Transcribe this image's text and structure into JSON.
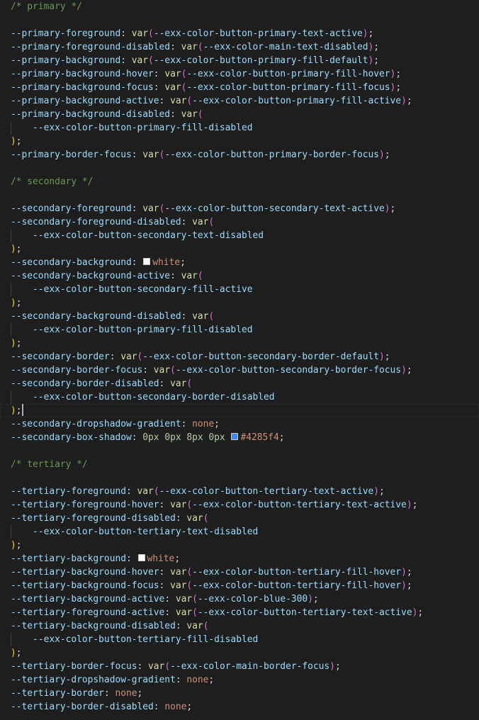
{
  "editor": {
    "colors": {
      "background": "#1e1e1e",
      "comment": "#6a9955",
      "property": "#9cdcfe",
      "function": "#dcdcaa",
      "paren": "#da70d6",
      "closing_paren": "#ffd700",
      "value": "#ce9178",
      "number": "#b5cea8",
      "punctuation": "#d4d4d4"
    },
    "cursor_line": 30,
    "lines": [
      {
        "tokens": [
          {
            "t": "/* primary */",
            "c": "comment"
          }
        ]
      },
      {
        "tokens": []
      },
      {
        "tokens": [
          {
            "t": "--primary-foreground",
            "c": "prop"
          },
          {
            "t": ": ",
            "c": "punct"
          },
          {
            "t": "var",
            "c": "fn"
          },
          {
            "t": "(",
            "c": "paren1"
          },
          {
            "t": "--exx-color-button-primary-text-active",
            "c": "var"
          },
          {
            "t": ")",
            "c": "paren1"
          },
          {
            "t": ";",
            "c": "punct"
          }
        ]
      },
      {
        "tokens": [
          {
            "t": "--primary-foreground-disabled",
            "c": "prop"
          },
          {
            "t": ": ",
            "c": "punct"
          },
          {
            "t": "var",
            "c": "fn"
          },
          {
            "t": "(",
            "c": "paren1"
          },
          {
            "t": "--exx-color-main-text-disabled",
            "c": "var"
          },
          {
            "t": ")",
            "c": "paren1"
          },
          {
            "t": ";",
            "c": "punct"
          }
        ]
      },
      {
        "tokens": [
          {
            "t": "--primary-background",
            "c": "prop"
          },
          {
            "t": ": ",
            "c": "punct"
          },
          {
            "t": "var",
            "c": "fn"
          },
          {
            "t": "(",
            "c": "paren1"
          },
          {
            "t": "--exx-color-button-primary-fill-default",
            "c": "var"
          },
          {
            "t": ")",
            "c": "paren1"
          },
          {
            "t": ";",
            "c": "punct"
          }
        ]
      },
      {
        "tokens": [
          {
            "t": "--primary-background-hover",
            "c": "prop"
          },
          {
            "t": ": ",
            "c": "punct"
          },
          {
            "t": "var",
            "c": "fn"
          },
          {
            "t": "(",
            "c": "paren1"
          },
          {
            "t": "--exx-color-button-primary-fill-hover",
            "c": "var"
          },
          {
            "t": ")",
            "c": "paren1"
          },
          {
            "t": ";",
            "c": "punct"
          }
        ]
      },
      {
        "tokens": [
          {
            "t": "--primary-background-focus",
            "c": "prop"
          },
          {
            "t": ": ",
            "c": "punct"
          },
          {
            "t": "var",
            "c": "fn"
          },
          {
            "t": "(",
            "c": "paren1"
          },
          {
            "t": "--exx-color-button-primary-fill-focus",
            "c": "var"
          },
          {
            "t": ")",
            "c": "paren1"
          },
          {
            "t": ";",
            "c": "punct"
          }
        ]
      },
      {
        "tokens": [
          {
            "t": "--primary-background-active",
            "c": "prop"
          },
          {
            "t": ": ",
            "c": "punct"
          },
          {
            "t": "var",
            "c": "fn"
          },
          {
            "t": "(",
            "c": "paren1"
          },
          {
            "t": "--exx-color-button-primary-fill-active",
            "c": "var"
          },
          {
            "t": ")",
            "c": "paren1"
          },
          {
            "t": ";",
            "c": "punct"
          }
        ]
      },
      {
        "tokens": [
          {
            "t": "--primary-background-disabled",
            "c": "prop"
          },
          {
            "t": ": ",
            "c": "punct"
          },
          {
            "t": "var",
            "c": "fn"
          },
          {
            "t": "(",
            "c": "paren1"
          }
        ]
      },
      {
        "guide": true,
        "tokens": [
          {
            "t": "    --exx-color-button-primary-fill-disabled",
            "c": "var"
          }
        ]
      },
      {
        "tokens": [
          {
            "t": ")",
            "c": "paren0"
          },
          {
            "t": ";",
            "c": "punct"
          }
        ]
      },
      {
        "tokens": [
          {
            "t": "--primary-border-focus",
            "c": "prop"
          },
          {
            "t": ": ",
            "c": "punct"
          },
          {
            "t": "var",
            "c": "fn"
          },
          {
            "t": "(",
            "c": "paren1"
          },
          {
            "t": "--exx-color-button-primary-border-focus",
            "c": "var"
          },
          {
            "t": ")",
            "c": "paren1"
          },
          {
            "t": ";",
            "c": "punct"
          }
        ]
      },
      {
        "tokens": []
      },
      {
        "tokens": [
          {
            "t": "/* secondary */",
            "c": "comment"
          }
        ]
      },
      {
        "tokens": []
      },
      {
        "tokens": [
          {
            "t": "--secondary-foreground",
            "c": "prop"
          },
          {
            "t": ": ",
            "c": "punct"
          },
          {
            "t": "var",
            "c": "fn"
          },
          {
            "t": "(",
            "c": "paren1"
          },
          {
            "t": "--exx-color-button-secondary-text-active",
            "c": "var"
          },
          {
            "t": ")",
            "c": "paren1"
          },
          {
            "t": ";",
            "c": "punct"
          }
        ]
      },
      {
        "tokens": [
          {
            "t": "--secondary-foreground-disabled",
            "c": "prop"
          },
          {
            "t": ": ",
            "c": "punct"
          },
          {
            "t": "var",
            "c": "fn"
          },
          {
            "t": "(",
            "c": "paren1"
          }
        ]
      },
      {
        "guide": true,
        "tokens": [
          {
            "t": "    --exx-color-button-secondary-text-disabled",
            "c": "var"
          }
        ]
      },
      {
        "tokens": [
          {
            "t": ")",
            "c": "paren0"
          },
          {
            "t": ";",
            "c": "punct"
          }
        ]
      },
      {
        "tokens": [
          {
            "t": "--secondary-background",
            "c": "prop"
          },
          {
            "t": ": ",
            "c": "punct"
          },
          {
            "swatch": "#ffffff"
          },
          {
            "t": "white",
            "c": "keyword"
          },
          {
            "t": ";",
            "c": "punct"
          }
        ]
      },
      {
        "tokens": [
          {
            "t": "--secondary-background-active",
            "c": "prop"
          },
          {
            "t": ": ",
            "c": "punct"
          },
          {
            "t": "var",
            "c": "fn"
          },
          {
            "t": "(",
            "c": "paren1"
          }
        ]
      },
      {
        "guide": true,
        "tokens": [
          {
            "t": "    --exx-color-button-secondary-fill-active",
            "c": "var"
          }
        ]
      },
      {
        "tokens": [
          {
            "t": ")",
            "c": "paren0"
          },
          {
            "t": ";",
            "c": "punct"
          }
        ]
      },
      {
        "tokens": [
          {
            "t": "--secondary-background-disabled",
            "c": "prop"
          },
          {
            "t": ": ",
            "c": "punct"
          },
          {
            "t": "var",
            "c": "fn"
          },
          {
            "t": "(",
            "c": "paren1"
          }
        ]
      },
      {
        "guide": true,
        "tokens": [
          {
            "t": "    --exx-color-button-primary-fill-disabled",
            "c": "var"
          }
        ]
      },
      {
        "tokens": [
          {
            "t": ")",
            "c": "paren0"
          },
          {
            "t": ";",
            "c": "punct"
          }
        ]
      },
      {
        "tokens": [
          {
            "t": "--secondary-border",
            "c": "prop"
          },
          {
            "t": ": ",
            "c": "punct"
          },
          {
            "t": "var",
            "c": "fn"
          },
          {
            "t": "(",
            "c": "paren1"
          },
          {
            "t": "--exx-color-button-secondary-border-default",
            "c": "var"
          },
          {
            "t": ")",
            "c": "paren1"
          },
          {
            "t": ";",
            "c": "punct"
          }
        ]
      },
      {
        "tokens": [
          {
            "t": "--secondary-border-focus",
            "c": "prop"
          },
          {
            "t": ": ",
            "c": "punct"
          },
          {
            "t": "var",
            "c": "fn"
          },
          {
            "t": "(",
            "c": "paren1"
          },
          {
            "t": "--exx-color-button-secondary-border-focus",
            "c": "var"
          },
          {
            "t": ")",
            "c": "paren1"
          },
          {
            "t": ";",
            "c": "punct"
          }
        ]
      },
      {
        "tokens": [
          {
            "t": "--secondary-border-disabled",
            "c": "prop"
          },
          {
            "t": ": ",
            "c": "punct"
          },
          {
            "t": "var",
            "c": "fn"
          },
          {
            "t": "(",
            "c": "paren1"
          }
        ]
      },
      {
        "guide": true,
        "tokens": [
          {
            "t": "    --exx-color-button-secondary-border-disabled",
            "c": "var"
          }
        ]
      },
      {
        "tokens": [
          {
            "t": ")",
            "c": "paren0"
          },
          {
            "t": ";",
            "c": "punct"
          },
          {
            "cursor": true
          }
        ]
      },
      {
        "tokens": [
          {
            "t": "--secondary-dropshadow-gradient",
            "c": "prop"
          },
          {
            "t": ": ",
            "c": "punct"
          },
          {
            "t": "none",
            "c": "keyword"
          },
          {
            "t": ";",
            "c": "punct"
          }
        ]
      },
      {
        "tokens": [
          {
            "t": "--secondary-box-shadow",
            "c": "prop"
          },
          {
            "t": ": ",
            "c": "punct"
          },
          {
            "t": "0px 0px 8px 0px ",
            "c": "number"
          },
          {
            "swatch": "#4285f4"
          },
          {
            "t": "#4285f4",
            "c": "keyword"
          },
          {
            "t": ";",
            "c": "punct"
          }
        ]
      },
      {
        "tokens": []
      },
      {
        "tokens": [
          {
            "t": "/* tertiary */",
            "c": "comment"
          }
        ]
      },
      {
        "tokens": []
      },
      {
        "tokens": [
          {
            "t": "--tertiary-foreground",
            "c": "prop"
          },
          {
            "t": ": ",
            "c": "punct"
          },
          {
            "t": "var",
            "c": "fn"
          },
          {
            "t": "(",
            "c": "paren1"
          },
          {
            "t": "--exx-color-button-tertiary-text-active",
            "c": "var"
          },
          {
            "t": ")",
            "c": "paren1"
          },
          {
            "t": ";",
            "c": "punct"
          }
        ]
      },
      {
        "tokens": [
          {
            "t": "--tertiary-foreground-hover",
            "c": "prop"
          },
          {
            "t": ": ",
            "c": "punct"
          },
          {
            "t": "var",
            "c": "fn"
          },
          {
            "t": "(",
            "c": "paren1"
          },
          {
            "t": "--exx-color-button-tertiary-text-active",
            "c": "var"
          },
          {
            "t": ")",
            "c": "paren1"
          },
          {
            "t": ";",
            "c": "punct"
          }
        ]
      },
      {
        "tokens": [
          {
            "t": "--tertiary-foreground-disabled",
            "c": "prop"
          },
          {
            "t": ": ",
            "c": "punct"
          },
          {
            "t": "var",
            "c": "fn"
          },
          {
            "t": "(",
            "c": "paren1"
          }
        ]
      },
      {
        "guide": true,
        "tokens": [
          {
            "t": "    --exx-color-button-tertiary-text-disabled",
            "c": "var"
          }
        ]
      },
      {
        "tokens": [
          {
            "t": ")",
            "c": "paren0"
          },
          {
            "t": ";",
            "c": "punct"
          }
        ]
      },
      {
        "tokens": [
          {
            "t": "--tertiary-background",
            "c": "prop"
          },
          {
            "t": ": ",
            "c": "punct"
          },
          {
            "swatch": "#ffffff"
          },
          {
            "t": "white",
            "c": "keyword"
          },
          {
            "t": ";",
            "c": "punct"
          }
        ]
      },
      {
        "tokens": [
          {
            "t": "--tertiary-background-hover",
            "c": "prop"
          },
          {
            "t": ": ",
            "c": "punct"
          },
          {
            "t": "var",
            "c": "fn"
          },
          {
            "t": "(",
            "c": "paren1"
          },
          {
            "t": "--exx-color-button-tertiary-fill-hover",
            "c": "var"
          },
          {
            "t": ")",
            "c": "paren1"
          },
          {
            "t": ";",
            "c": "punct"
          }
        ]
      },
      {
        "tokens": [
          {
            "t": "--tertiary-background-focus",
            "c": "prop"
          },
          {
            "t": ": ",
            "c": "punct"
          },
          {
            "t": "var",
            "c": "fn"
          },
          {
            "t": "(",
            "c": "paren1"
          },
          {
            "t": "--exx-color-button-tertiary-fill-hover",
            "c": "var"
          },
          {
            "t": ")",
            "c": "paren1"
          },
          {
            "t": ";",
            "c": "punct"
          }
        ]
      },
      {
        "tokens": [
          {
            "t": "--tertiary-background-active",
            "c": "prop"
          },
          {
            "t": ": ",
            "c": "punct"
          },
          {
            "t": "var",
            "c": "fn"
          },
          {
            "t": "(",
            "c": "paren1"
          },
          {
            "t": "--exx-color-blue-300",
            "c": "var"
          },
          {
            "t": ")",
            "c": "paren1"
          },
          {
            "t": ";",
            "c": "punct"
          }
        ]
      },
      {
        "tokens": [
          {
            "t": "--tertiary-foreground-active",
            "c": "prop"
          },
          {
            "t": ": ",
            "c": "punct"
          },
          {
            "t": "var",
            "c": "fn"
          },
          {
            "t": "(",
            "c": "paren1"
          },
          {
            "t": "--exx-color-button-tertiary-text-active",
            "c": "var"
          },
          {
            "t": ")",
            "c": "paren1"
          },
          {
            "t": ";",
            "c": "punct"
          }
        ]
      },
      {
        "tokens": [
          {
            "t": "--tertiary-background-disabled",
            "c": "prop"
          },
          {
            "t": ": ",
            "c": "punct"
          },
          {
            "t": "var",
            "c": "fn"
          },
          {
            "t": "(",
            "c": "paren1"
          }
        ]
      },
      {
        "guide": true,
        "tokens": [
          {
            "t": "    --exx-color-button-tertiary-fill-disabled",
            "c": "var"
          }
        ]
      },
      {
        "tokens": [
          {
            "t": ")",
            "c": "paren0"
          },
          {
            "t": ";",
            "c": "punct"
          }
        ]
      },
      {
        "tokens": [
          {
            "t": "--tertiary-border-focus",
            "c": "prop"
          },
          {
            "t": ": ",
            "c": "punct"
          },
          {
            "t": "var",
            "c": "fn"
          },
          {
            "t": "(",
            "c": "paren1"
          },
          {
            "t": "--exx-color-main-border-focus",
            "c": "var"
          },
          {
            "t": ")",
            "c": "paren1"
          },
          {
            "t": ";",
            "c": "punct"
          }
        ]
      },
      {
        "tokens": [
          {
            "t": "--tertiary-dropshadow-gradient",
            "c": "prop"
          },
          {
            "t": ": ",
            "c": "punct"
          },
          {
            "t": "none",
            "c": "keyword"
          },
          {
            "t": ";",
            "c": "punct"
          }
        ]
      },
      {
        "tokens": [
          {
            "t": "--tertiary-border",
            "c": "prop"
          },
          {
            "t": ": ",
            "c": "punct"
          },
          {
            "t": "none",
            "c": "keyword"
          },
          {
            "t": ";",
            "c": "punct"
          }
        ]
      },
      {
        "tokens": [
          {
            "t": "--tertiary-border-disabled",
            "c": "prop"
          },
          {
            "t": ": ",
            "c": "punct"
          },
          {
            "t": "none",
            "c": "keyword"
          },
          {
            "t": ";",
            "c": "punct"
          }
        ]
      }
    ]
  }
}
